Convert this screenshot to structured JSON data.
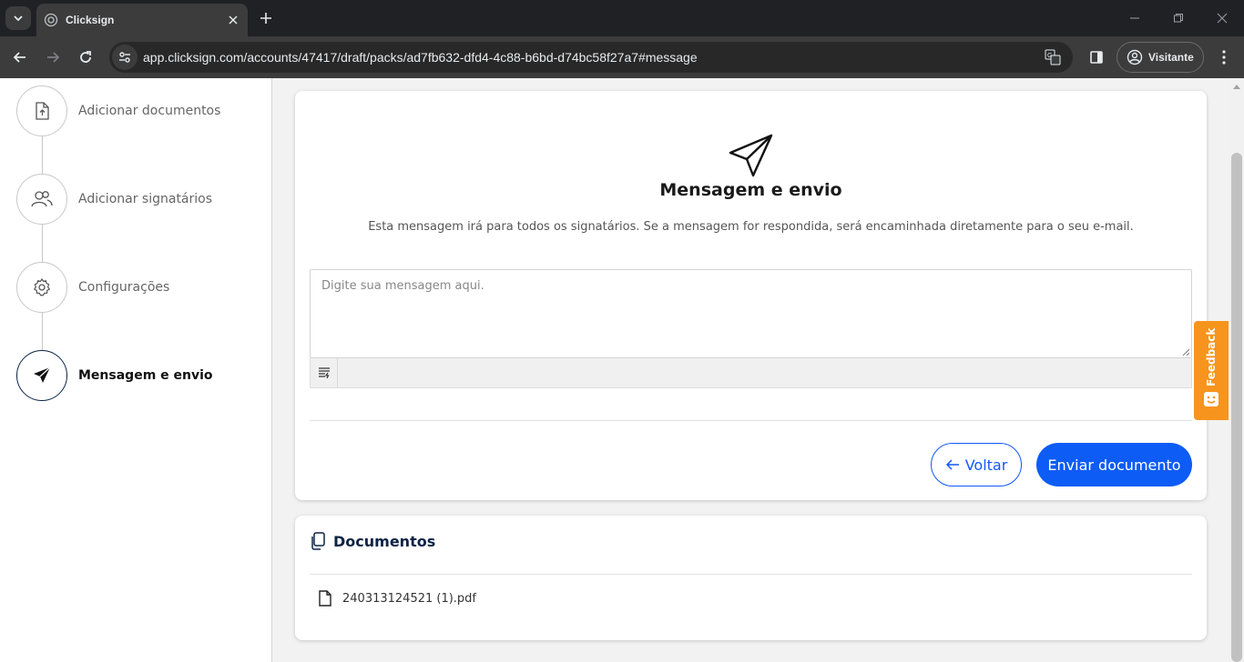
{
  "browser": {
    "tab_title": "Clicksign",
    "url": "app.clicksign.com/accounts/47417/draft/packs/ad7fb632-dfd4-4c88-b6bd-d74bc58f27a7#message",
    "profile_label": "Visitante"
  },
  "sidebar": {
    "steps": [
      {
        "label": "Adicionar documentos",
        "icon": "file-upload-icon"
      },
      {
        "label": "Adicionar signatários",
        "icon": "users-icon"
      },
      {
        "label": "Configurações",
        "icon": "gear-icon"
      },
      {
        "label": "Mensagem e envio",
        "icon": "paper-plane-icon",
        "active": true
      }
    ]
  },
  "message_card": {
    "title": "Mensagem e envio",
    "description": "Esta mensagem irá para todos os signatários. Se a mensagem for respondida, será encaminhada diretamente para o seu e-mail.",
    "textarea_placeholder": "Digite sua mensagem aqui.",
    "back_label": "Voltar",
    "send_label": "Enviar documento"
  },
  "documents_card": {
    "title": "Documentos",
    "files": [
      {
        "name": "240313124521 (1).pdf"
      }
    ]
  },
  "feedback": {
    "label": "Feedback"
  },
  "colors": {
    "primary": "#0d5cf5",
    "navy": "#0c2445",
    "feedback": "#f7941d"
  }
}
